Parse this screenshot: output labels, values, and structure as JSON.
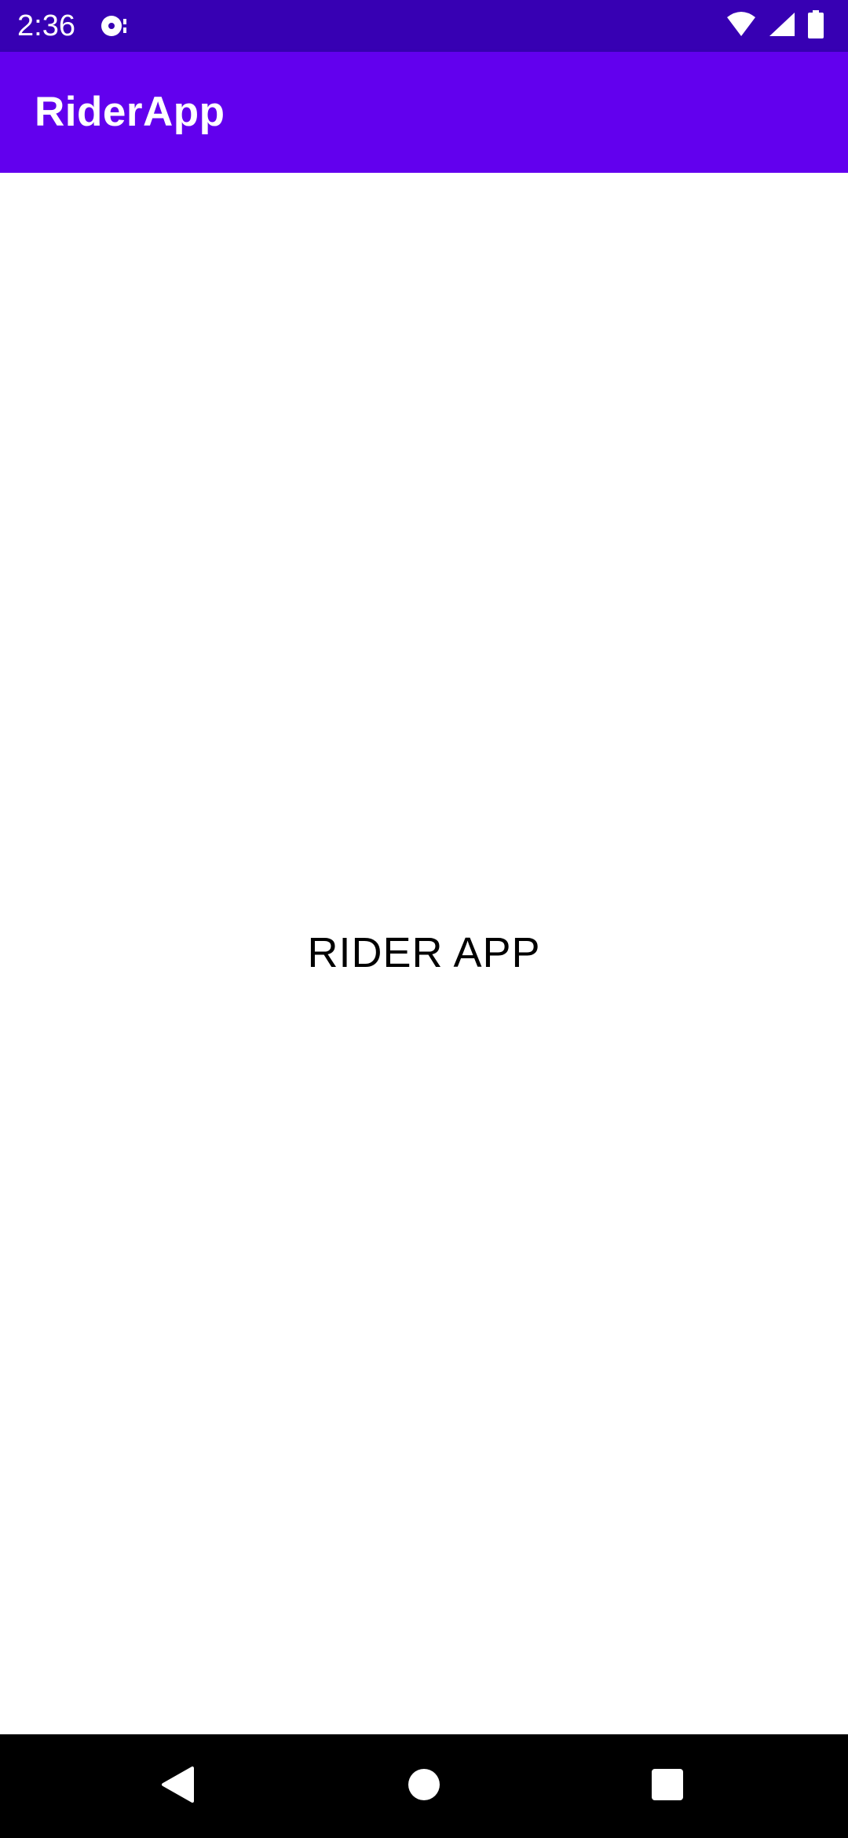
{
  "status_bar": {
    "time": "2:36",
    "icons": [
      "notification-disc-icon",
      "wifi-icon",
      "cellular-signal-icon",
      "battery-icon"
    ],
    "color": "#3700b3"
  },
  "app_bar": {
    "title": "RiderApp",
    "color": "#6200ee"
  },
  "main": {
    "center_text": "RIDER APP"
  },
  "nav_bar": {
    "buttons": [
      "back-icon",
      "home-icon",
      "recents-icon"
    ],
    "color": "#000000"
  }
}
